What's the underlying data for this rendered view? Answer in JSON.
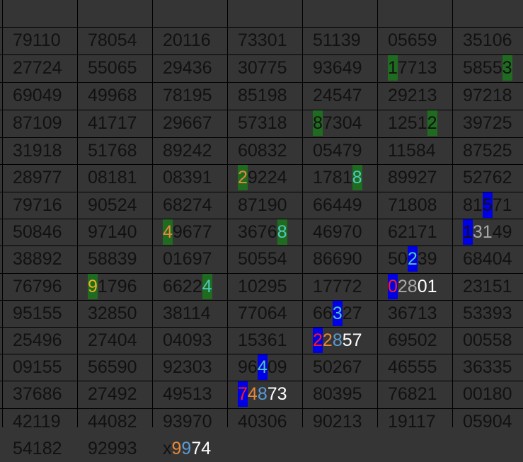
{
  "rows": [
    [
      "79110",
      "78054",
      "20116",
      "73301",
      "51139",
      "05659",
      "35106"
    ],
    [
      "27724",
      "55065",
      "29436",
      "30775",
      "93649",
      [
        {
          "t": "1",
          "c": "black",
          "h": "green"
        },
        {
          "t": "7713",
          "c": "black"
        }
      ],
      [
        {
          "t": "5855",
          "c": "black"
        },
        {
          "t": "3",
          "c": "black",
          "h": "green"
        }
      ]
    ],
    [
      "69049",
      "49968",
      "78195",
      "85198",
      "24547",
      "29213",
      "97218"
    ],
    [
      "87109",
      "41717",
      "29667",
      "57318",
      [
        {
          "t": "8",
          "c": "black",
          "h": "green"
        },
        {
          "t": "7304",
          "c": "black"
        }
      ],
      [
        {
          "t": "1251",
          "c": "black"
        },
        {
          "t": "2",
          "c": "black",
          "h": "green"
        }
      ],
      "39725"
    ],
    [
      "31918",
      "51768",
      "89242",
      "60832",
      "05479",
      "11584",
      "87525"
    ],
    [
      "28977",
      "08181",
      "08391",
      [
        {
          "t": "2",
          "c": "orange",
          "h": "green"
        },
        {
          "t": "9224",
          "c": "black"
        }
      ],
      [
        {
          "t": "1781",
          "c": "black"
        },
        {
          "t": "8",
          "c": "cyan",
          "h": "green"
        }
      ],
      "89927",
      "52762"
    ],
    [
      "79716",
      "90524",
      "68274",
      "87190",
      "66449",
      "71808",
      [
        {
          "t": "81",
          "c": "black"
        },
        {
          "t": "5",
          "c": "black",
          "h": "blue"
        },
        {
          "t": "71",
          "c": "black"
        }
      ]
    ],
    [
      "50846",
      "97140",
      [
        {
          "t": "4",
          "c": "orange",
          "h": "green"
        },
        {
          "t": "9677",
          "c": "black"
        }
      ],
      [
        {
          "t": "3676",
          "c": "black"
        },
        {
          "t": "8",
          "c": "cyan",
          "h": "green"
        }
      ],
      "46970",
      "62171",
      [
        {
          "t": "1",
          "c": "black",
          "h": "blue"
        },
        {
          "t": "31",
          "c": "gray"
        },
        {
          "t": "49",
          "c": "black"
        }
      ]
    ],
    [
      "38892",
      "58839",
      "01697",
      "50554",
      "86690",
      [
        {
          "t": "50",
          "c": "black"
        },
        {
          "t": "2",
          "c": "cyan",
          "h": "blue"
        },
        {
          "t": "39",
          "c": "black"
        }
      ],
      "68404"
    ],
    [
      "76796",
      [
        {
          "t": "9",
          "c": "yellow",
          "h": "green"
        },
        {
          "t": "1796",
          "c": "black"
        }
      ],
      [
        {
          "t": "6622",
          "c": "black"
        },
        {
          "t": "4",
          "c": "cyan",
          "h": "green"
        }
      ],
      "10295",
      "17772",
      [
        {
          "t": "0",
          "c": "red",
          "h": "blue"
        },
        {
          "t": "28",
          "c": "gray"
        },
        {
          "t": "01",
          "c": "white"
        }
      ],
      "23151"
    ],
    [
      "95155",
      "32850",
      "38114",
      "77064",
      [
        {
          "t": "66",
          "c": "black"
        },
        {
          "t": "3",
          "c": "cyan",
          "h": "blue"
        },
        {
          "t": "27",
          "c": "black"
        }
      ],
      "36713",
      "53393"
    ],
    [
      "25496",
      "27404",
      "04093",
      "15361",
      [
        {
          "t": "2",
          "c": "red",
          "h": "blue"
        },
        {
          "t": "2",
          "c": "orange"
        },
        {
          "t": "8",
          "c": "blue"
        },
        {
          "t": "57",
          "c": "white"
        }
      ],
      "69502",
      "00558"
    ],
    [
      "09155",
      "56590",
      "92303",
      [
        {
          "t": "96",
          "c": "black"
        },
        {
          "t": "4",
          "c": "cyan",
          "h": "blue"
        },
        {
          "t": "09",
          "c": "black"
        }
      ],
      "50267",
      "46555",
      "36335"
    ],
    [
      "37686",
      "27492",
      "49513",
      [
        {
          "t": "7",
          "c": "red",
          "h": "blue"
        },
        {
          "t": "4",
          "c": "orange"
        },
        {
          "t": "8",
          "c": "blue"
        },
        {
          "t": "73",
          "c": "white"
        }
      ],
      "80395",
      "76821",
      "00180"
    ],
    [
      "42119",
      "44082",
      "93970",
      "40306",
      "90213",
      "19117",
      "05904"
    ],
    [
      "54182",
      "92993",
      [
        {
          "t": "x",
          "c": "black"
        },
        {
          "t": "9",
          "c": "orange"
        },
        {
          "t": "9",
          "c": "blue"
        },
        {
          "t": "74",
          "c": "white"
        }
      ],
      "",
      "",
      "",
      ""
    ]
  ]
}
